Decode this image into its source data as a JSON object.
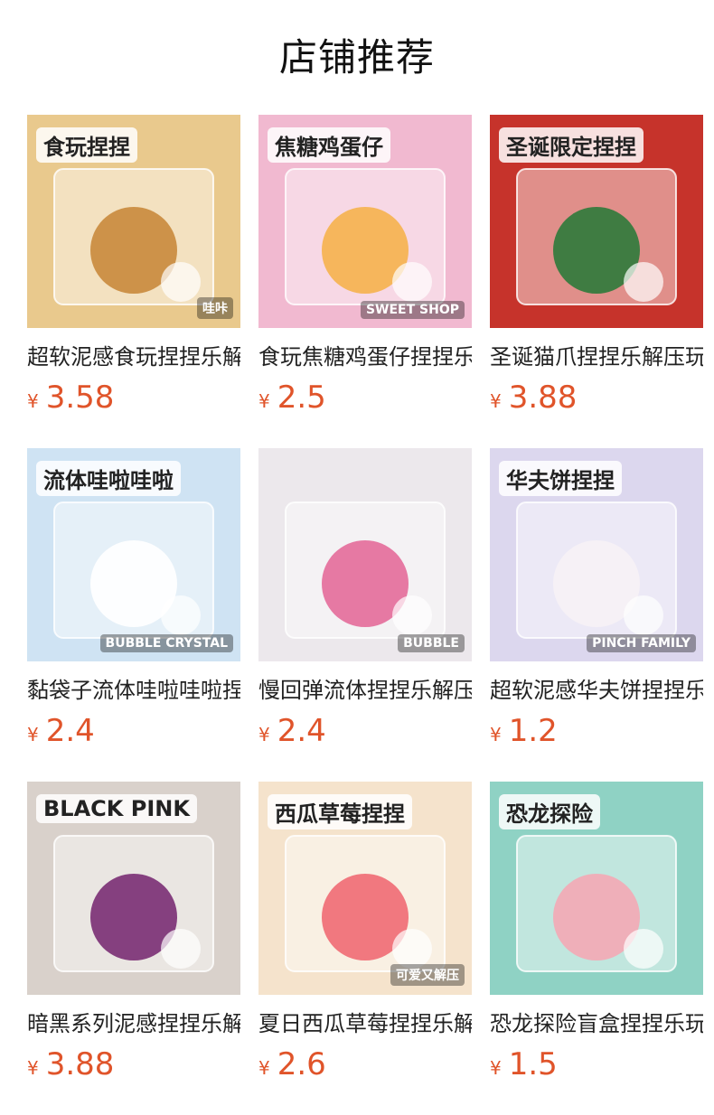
{
  "header": {
    "title": "店铺推荐"
  },
  "currency_symbol": "¥",
  "products": [
    {
      "title": "超软泥感食玩捏捏乐解压",
      "price": "3.58",
      "tag": "食玩捏捏",
      "corner": "哇咔",
      "bg": "#e9c98d",
      "accent": "#c98a3c"
    },
    {
      "title": "食玩焦糖鸡蛋仔捏捏乐",
      "price": "2.5",
      "tag": "焦糖鸡蛋仔",
      "corner": "SWEET SHOP",
      "bg": "#f1b9d0",
      "accent": "#f5b24c"
    },
    {
      "title": "圣诞猫爪捏捏乐解压玩具",
      "price": "3.88",
      "tag": "圣诞限定捏捏",
      "corner": "",
      "bg": "#c6332b",
      "accent": "#2d7a3a"
    },
    {
      "title": "黏袋子流体哇啦哇啦捏捏",
      "price": "2.4",
      "tag": "流体哇啦哇啦",
      "corner": "BUBBLE CRYSTAL",
      "bg": "#cfe3f3",
      "accent": "#ffffff"
    },
    {
      "title": "慢回弹流体捏捏乐解压",
      "price": "2.4",
      "tag": "",
      "corner": "BUBBLE",
      "bg": "#ece8ec",
      "accent": "#e46b9a"
    },
    {
      "title": "超软泥感华夫饼捏捏乐",
      "price": "1.2",
      "tag": "华夫饼捏捏",
      "corner": "PINCH FAMILY",
      "bg": "#dcd7ee",
      "accent": "#f7f2f6"
    },
    {
      "title": "暗黑系列泥感捏捏乐解压",
      "price": "3.88",
      "tag": "BLACK PINK",
      "corner": "",
      "bg": "#d9d1cb",
      "accent": "#7a2d74"
    },
    {
      "title": "夏日西瓜草莓捏捏乐解压",
      "price": "2.6",
      "tag": "西瓜草莓捏捏",
      "corner": "可爱又解压",
      "bg": "#f5e3cc",
      "accent": "#ef6a73"
    },
    {
      "title": "恐龙探险盲盒捏捏乐玩具",
      "price": "1.5",
      "tag": "恐龙探险",
      "corner": "",
      "bg": "#8fd2c4",
      "accent": "#f4a9b5"
    }
  ]
}
